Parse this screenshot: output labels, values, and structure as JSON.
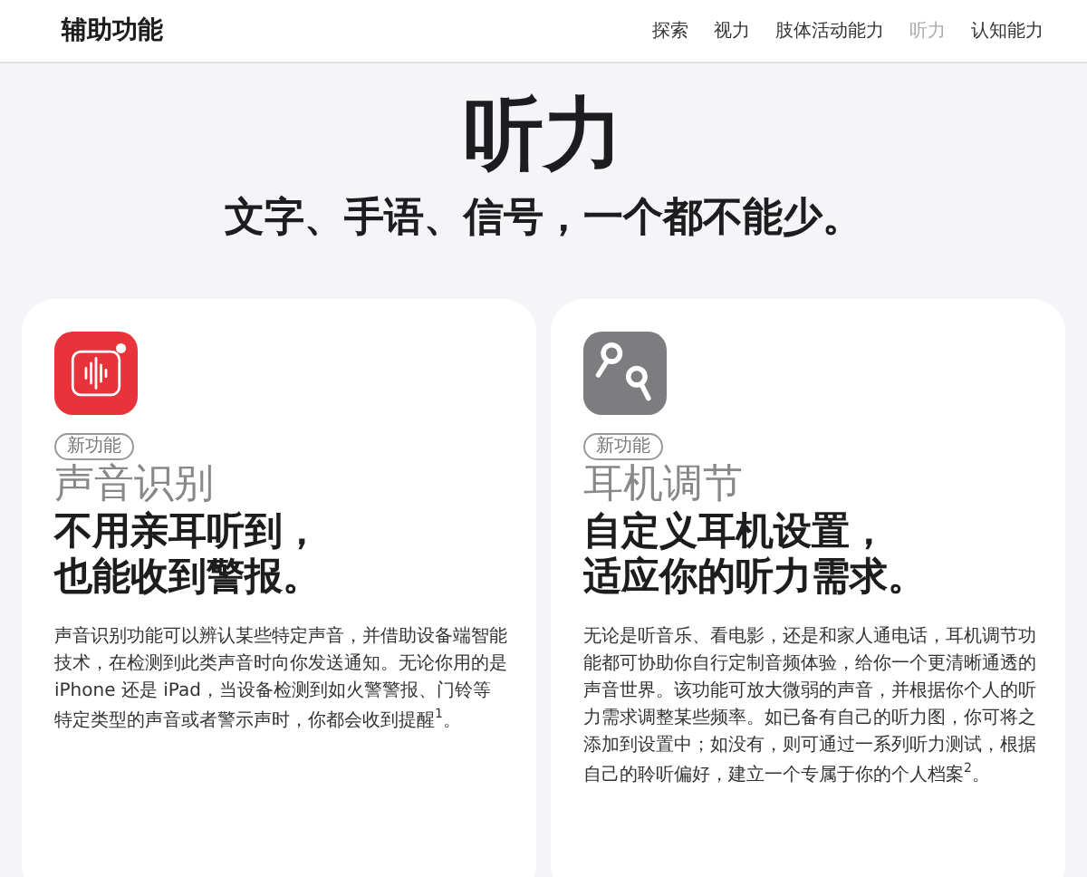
{
  "header": {
    "title": "辅助功能",
    "nav": [
      {
        "label": "探索",
        "selected": false
      },
      {
        "label": "视力",
        "selected": false
      },
      {
        "label": "肢体活动能力",
        "selected": false
      },
      {
        "label": "听力",
        "selected": true
      },
      {
        "label": "认知能力",
        "selected": false
      }
    ]
  },
  "hero": {
    "title": "听力",
    "subtitle": "文字、手语、信号，一个都不能少。"
  },
  "cards": [
    {
      "kind": "sound",
      "badge": "新功能",
      "title": "声音识别",
      "headline": [
        "不用亲耳听到，",
        "也能收到警报。"
      ],
      "body": "声音识别功能可以辨认某些特定声音，并借助设备端智能技术，在检测到此类声音时向你发送通知。无论你用的是 iPhone 还是 iPad，当设备检测到如火警警报、门铃等特定类型的声音或者警示声时，你都会收到提醒$^{1}$。"
    },
    {
      "kind": "earbuds",
      "badge": "新功能",
      "title": "耳机调节",
      "headline": [
        "自定义耳机设置，",
        "适应你的听力需求。"
      ],
      "body": "无论是听音乐、看电影，还是和家人通电话，耳机调节功能都可协助你自行定制音频体验，给你一个更清晰通透的声音世界。该功能可放大微弱的声音，并根据你个人的听力需求调整某些频率。如已备有自己的听力图，你可将之添加到设置中；如没有，则可通过一系列听力测试，根据自己的聆听偏好，建立一个专属于你的个人档案$^{2}$。"
    }
  ]
}
